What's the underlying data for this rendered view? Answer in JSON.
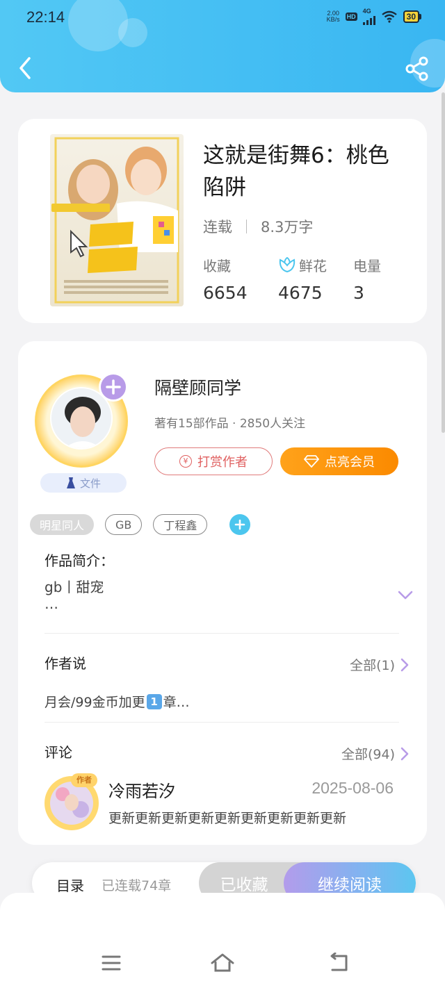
{
  "status_bar": {
    "time": "22:14",
    "net_speed_value": "2.00",
    "net_speed_unit": "KB/s",
    "hd_label": "HD",
    "network_type": "4G",
    "battery_level": "30"
  },
  "book": {
    "title": "这就是街舞6：桃色陷阱",
    "status": "连载",
    "word_count": "8.3万字",
    "stats": [
      {
        "label": "收藏",
        "value": "6654"
      },
      {
        "label": "鲜花",
        "value": "4675",
        "icon": "flower-icon"
      },
      {
        "label": "电量",
        "value": "3"
      }
    ]
  },
  "author": {
    "name": "隔壁顾同学",
    "info": "著有15部作品 · 2850人关注",
    "badge_label": "文件",
    "tip_button": "打赏作者",
    "tip_icon_glyph": "¥",
    "vip_button": "点亮会员"
  },
  "tags": [
    "明星同人",
    "GB",
    "丁程鑫"
  ],
  "intro": {
    "heading": "作品简介：",
    "line1": "gb丨甜宠",
    "line2": "…"
  },
  "author_says": {
    "heading": "作者说",
    "more": "全部(1)",
    "text_before": "月会/99金币加更",
    "keycap": "1",
    "text_after": "章…"
  },
  "comments": {
    "heading": "评论",
    "more": "全部(94)",
    "items": [
      {
        "name": "冷雨若汐",
        "date": "2025-08-06",
        "text": "更新更新更新更新更新更新更新更新更新",
        "badge": "作者"
      }
    ]
  },
  "bottom_bar": {
    "toc": "目录",
    "chapters": "已连载74章",
    "collected": "已收藏",
    "continue": "继续阅读"
  },
  "colors": {
    "header": "#3fbaf2",
    "vip": "#fb8a00",
    "tip": "#e06060",
    "accent_blue": "#4cc6ee",
    "accent_purple": "#b89be8"
  }
}
